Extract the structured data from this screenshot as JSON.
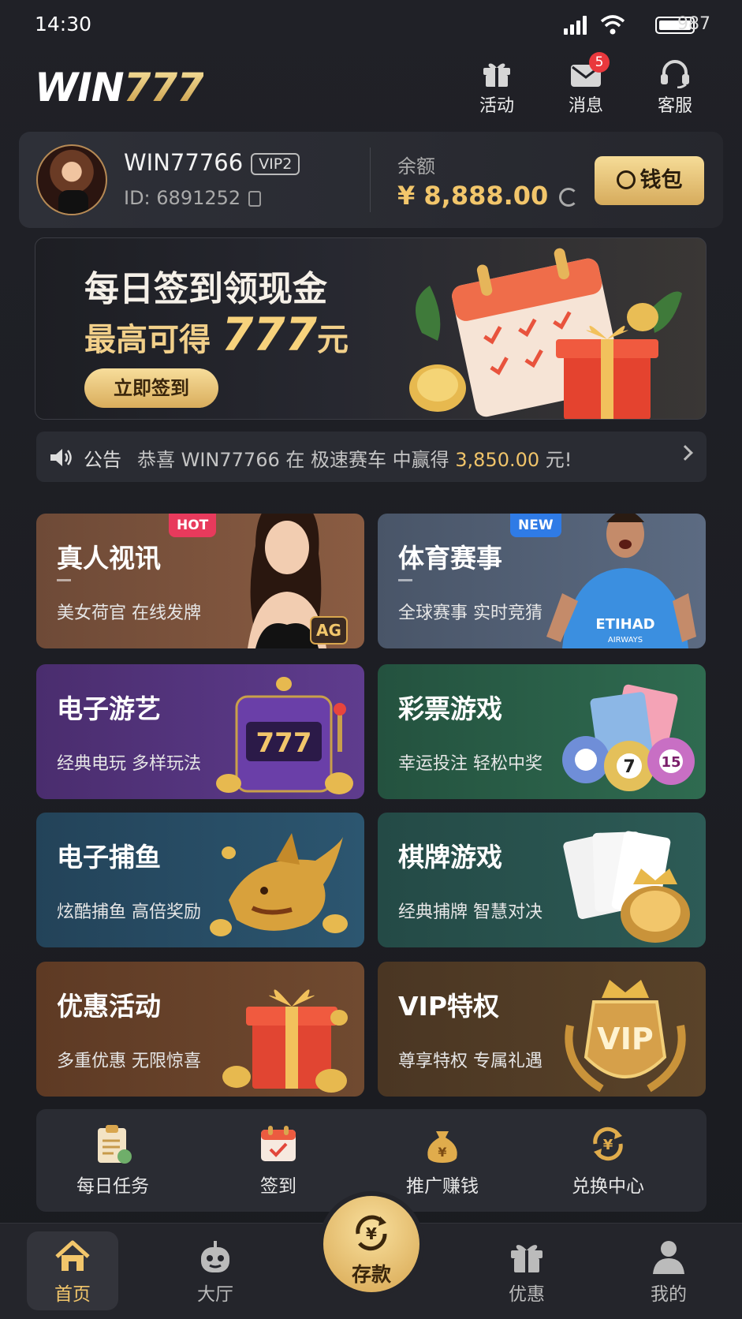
{
  "status_bar": {
    "time": "14:30",
    "battery": "987"
  },
  "header": {
    "logo_main": "WIN",
    "logo_num": "777",
    "buttons": [
      {
        "label": "活动",
        "icon": "gift-icon"
      },
      {
        "label": "消息",
        "icon": "mail-icon",
        "badge": "5"
      },
      {
        "label": "客服",
        "icon": "headset-icon"
      }
    ]
  },
  "user": {
    "name": "WIN77766",
    "vip": "VIP2",
    "id": "ID: 6891252",
    "balance_label": "余额",
    "balance": "¥ 8,888.00",
    "wallet_label": "钱包"
  },
  "banner": {
    "title": "每日签到领现金",
    "subtitle_pre": "最高可得 ",
    "subtitle_amount": "777",
    "subtitle_unit": "元",
    "button": "立即签到"
  },
  "notice": {
    "label": "公告",
    "text": "恭喜 WIN77766 在 极速赛车 中赢得 ",
    "amount": "3,850.00",
    "suffix": " 元!"
  },
  "games": [
    {
      "title": "真人视讯",
      "subtitle": "美女荷官 在线发牌",
      "tag": "HOT",
      "tag_color": "#e83a5c",
      "logo": "AG"
    },
    {
      "title": "体育赛事",
      "subtitle": "全球赛事 实时竞猜",
      "tag": "NEW",
      "tag_color": "#2f7be6",
      "jersey_text": "ETIHAD",
      "jersey_sub": "AIRWAYS"
    },
    {
      "title": "电子游艺",
      "subtitle": "经典电玩 多样玩法",
      "slot_text": "777"
    },
    {
      "title": "彩票游戏",
      "subtitle": "幸运投注 轻松中奖",
      "ball_a": "7",
      "ball_b": "15"
    },
    {
      "title": "电子捕鱼",
      "subtitle": "炫酷捕鱼 高倍奖励"
    },
    {
      "title": "棋牌游戏",
      "subtitle": "经典捕牌 智慧对决"
    },
    {
      "title": "优惠活动",
      "subtitle": "多重优惠 无限惊喜"
    },
    {
      "title": "VIP特权",
      "subtitle": "尊享特权 专属礼遇",
      "badge_text": "VIP"
    }
  ],
  "quick": [
    {
      "label": "每日任务",
      "icon": "clipboard-icon"
    },
    {
      "label": "签到",
      "icon": "calendar-icon"
    },
    {
      "label": "推广赚钱",
      "icon": "money-bag-icon"
    },
    {
      "label": "兑换中心",
      "icon": "exchange-icon"
    }
  ],
  "tabbar": {
    "home": "首页",
    "lobby": "大厅",
    "deposit": "存款",
    "promo": "优惠",
    "mine": "我的"
  },
  "colors": {
    "gold": "#f2c66b",
    "bg": "#1b1c21",
    "hot": "#e83a5c",
    "new": "#2f7be6"
  }
}
